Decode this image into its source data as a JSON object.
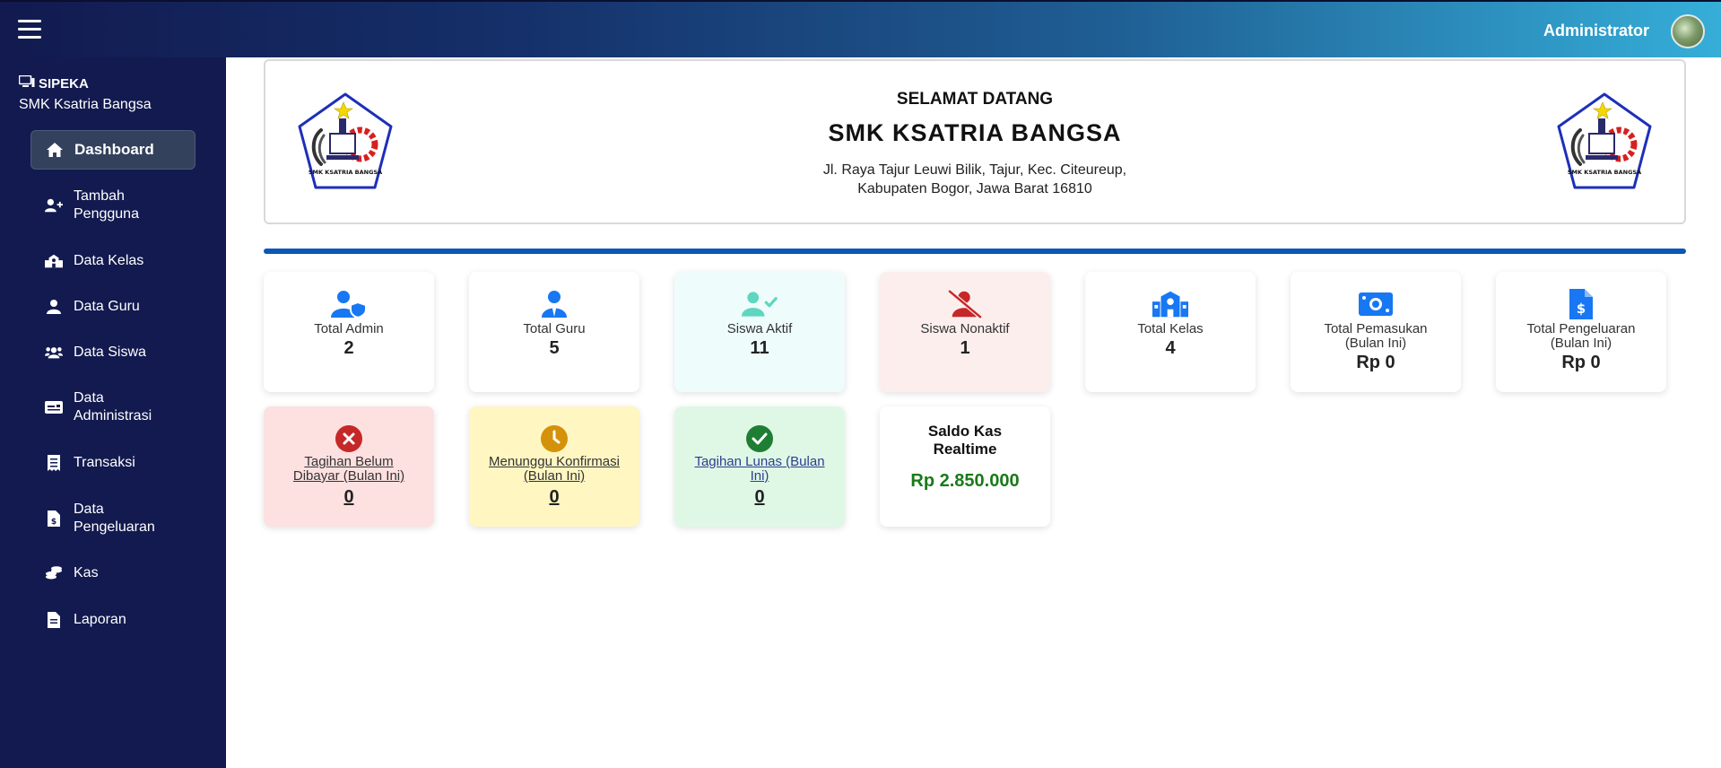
{
  "header": {
    "admin_name": "Administrator"
  },
  "brand": {
    "app_name": "SIPEKA",
    "school": "SMK Ksatria Bangsa"
  },
  "sidebar": {
    "items": [
      {
        "label": "Dashboard",
        "icon": "home-icon",
        "active": true
      },
      {
        "label": "Tambah\nPengguna",
        "icon": "user-plus-icon"
      },
      {
        "label": "Data Kelas",
        "icon": "school-icon"
      },
      {
        "label": "Data Guru",
        "icon": "user-tie-icon"
      },
      {
        "label": "Data Siswa",
        "icon": "users-icon"
      },
      {
        "label": "Data\nAdministrasi",
        "icon": "id-card-icon"
      },
      {
        "label": "Transaksi",
        "icon": "receipt-icon"
      },
      {
        "label": "Data\nPengeluaran",
        "icon": "file-invoice-dollar-icon"
      },
      {
        "label": "Kas",
        "icon": "coins-icon"
      },
      {
        "label": "Laporan",
        "icon": "file-icon"
      }
    ]
  },
  "welcome": {
    "greeting": "SELAMAT DATANG",
    "school": "SMK KSATRIA BANGSA",
    "address_line1": "Jl. Raya Tajur Leuwi Bilik, Tajur, Kec. Citeureup,",
    "address_line2": "Kabupaten Bogor, Jawa Barat 16810",
    "logo_text": "SMK KSATRIA BANGSA"
  },
  "stats": {
    "total_admin": {
      "label": "Total Admin",
      "value": "2"
    },
    "total_guru": {
      "label": "Total Guru",
      "value": "5"
    },
    "siswa_aktif": {
      "label": "Siswa Aktif",
      "value": "11"
    },
    "siswa_nonaktif": {
      "label": "Siswa Nonaktif",
      "value": "1"
    },
    "total_kelas": {
      "label": "Total Kelas",
      "value": "4"
    },
    "total_pemasukan": {
      "label1": "Total Pemasukan",
      "label2": "(Bulan Ini)",
      "value": "Rp 0"
    },
    "total_pengeluaran": {
      "label1": "Total Pengeluaran",
      "label2": "(Bulan Ini)",
      "value": "Rp 0"
    }
  },
  "billing": {
    "belum_dibayar": {
      "label1": "Tagihan Belum",
      "label2": "Dibayar (Bulan Ini)",
      "value": "0"
    },
    "menunggu": {
      "label1": "Menunggu Konfirmasi",
      "label2": "(Bulan Ini)",
      "value": "0"
    },
    "lunas": {
      "label1": "Tagihan Lunas (Bulan",
      "label2": "Ini)",
      "value": "0"
    },
    "saldo": {
      "label1": "Saldo Kas",
      "label2": "Realtime",
      "value": "Rp 2.850.000"
    }
  },
  "colors": {
    "blue": "#1877f2",
    "teal": "#5fd6bf",
    "red": "#c62828",
    "aktif_bg": "#eefcfc",
    "nonaktif_bg": "#fdeeee",
    "belum_bg": "#fde0e0",
    "menunggu_bg": "#fff6c2",
    "lunas_bg": "#dff8e6",
    "saldo_green": "#1a7a1a"
  }
}
